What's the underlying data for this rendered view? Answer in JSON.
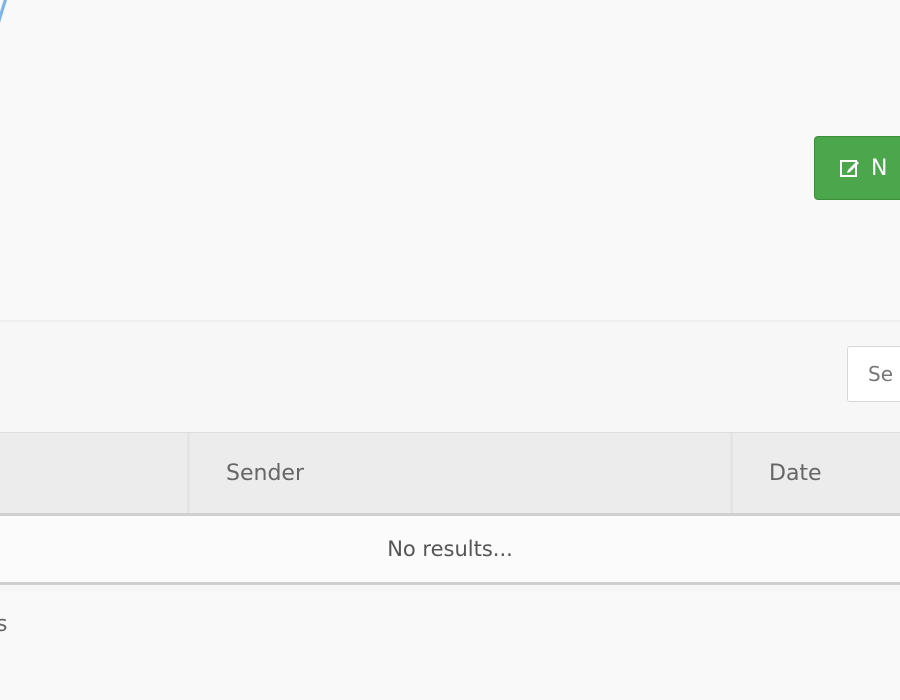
{
  "header": {
    "title_fragment": "/"
  },
  "toolbar": {
    "new_label": "N"
  },
  "search": {
    "placeholder": "Se"
  },
  "table": {
    "columns": [
      "",
      "Sender",
      "Date"
    ],
    "empty_message": "No results..."
  },
  "footer": {
    "info_fragment": "s"
  },
  "colors": {
    "accent_green": "#4ca64c",
    "title_blue": "#7fb4e6"
  },
  "icons": {
    "new_button_icon": "edit-icon"
  }
}
